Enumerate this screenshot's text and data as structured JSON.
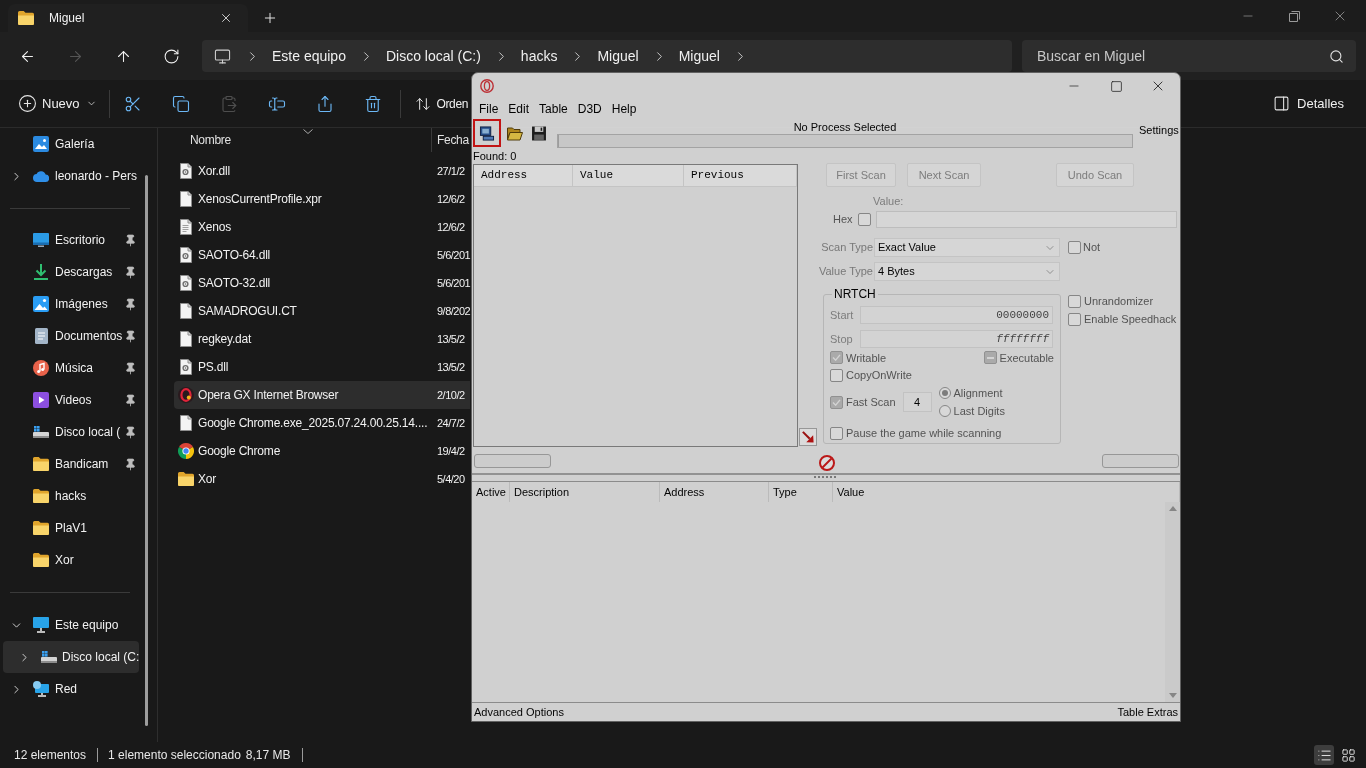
{
  "explorer": {
    "tab": {
      "title": "Miguel"
    },
    "nav_buttons": [
      {
        "kind": "back",
        "disabled": false
      },
      {
        "kind": "forward",
        "disabled": true
      },
      {
        "kind": "up",
        "disabled": false
      },
      {
        "kind": "refresh",
        "disabled": false
      }
    ],
    "breadcrumb": [
      "Este equipo",
      "Disco local (C:)",
      "hacks",
      "Miguel",
      "Miguel"
    ],
    "search": {
      "placeholder": "Buscar en Miguel"
    },
    "command_bar": {
      "new": "Nuevo",
      "tools": [
        {
          "kind": "cut",
          "disabled": false
        },
        {
          "kind": "copy",
          "disabled": false
        },
        {
          "kind": "paste",
          "disabled": true
        },
        {
          "kind": "rename",
          "disabled": false
        },
        {
          "kind": "share",
          "disabled": false
        },
        {
          "kind": "delete",
          "disabled": false
        }
      ],
      "sort": "Orden",
      "details": "Detalles"
    },
    "sidebar": {
      "groups": [
        [
          {
            "label": "Galería",
            "kind": "gallery",
            "pinned": false,
            "selected": false
          },
          {
            "label": "leonardo - Pers",
            "kind": "cloud",
            "expanded": false,
            "pinned": false,
            "selected": false
          }
        ],
        [
          {
            "label": "Escritorio",
            "kind": "desktop",
            "pinned": true,
            "selected": false
          },
          {
            "label": "Descargas",
            "kind": "downloads",
            "pinned": true,
            "selected": false
          },
          {
            "label": "Imágenes",
            "kind": "pictures",
            "pinned": true,
            "selected": false
          },
          {
            "label": "Documentos",
            "kind": "documents",
            "pinned": true,
            "selected": false
          },
          {
            "label": "Música",
            "kind": "music",
            "pinned": true,
            "selected": false
          },
          {
            "label": "Videos",
            "kind": "videos",
            "pinned": true,
            "selected": false
          },
          {
            "label": "Disco local (",
            "kind": "drive",
            "pinned": true,
            "selected": false
          },
          {
            "label": "Bandicam",
            "kind": "folder",
            "pinned": true,
            "selected": false
          },
          {
            "label": "hacks",
            "kind": "folder",
            "pinned": false,
            "selected": false
          },
          {
            "label": "PlaV1",
            "kind": "folder",
            "pinned": false,
            "selected": false
          },
          {
            "label": "Xor",
            "kind": "folder",
            "pinned": false,
            "selected": false
          }
        ],
        [
          {
            "label": "Este equipo",
            "kind": "pc",
            "expanded": true,
            "pinned": false,
            "selected": false,
            "children": [
              {
                "label": "Disco local (C:",
                "kind": "drive",
                "expanded": false,
                "pinned": false,
                "selected": true
              }
            ]
          },
          {
            "label": "Red",
            "kind": "network",
            "expanded": false,
            "pinned": false,
            "selected": false
          }
        ]
      ]
    },
    "files": {
      "columns": [
        {
          "label": "Nombre",
          "sorted": true
        },
        {
          "label": "Fecha",
          "sorted": false
        }
      ],
      "rows": [
        {
          "name": "Xor.dll",
          "kind": "dll",
          "date": "27/1/2",
          "selected": false
        },
        {
          "name": "XenosCurrentProfile.xpr",
          "kind": "file",
          "date": "12/6/2",
          "selected": false
        },
        {
          "name": "Xenos",
          "kind": "text",
          "date": "12/6/2",
          "selected": false
        },
        {
          "name": "SAOTO-64.dll",
          "kind": "dll",
          "date": "5/6/201",
          "selected": false
        },
        {
          "name": "SAOTO-32.dll",
          "kind": "dll",
          "date": "5/6/201",
          "selected": false
        },
        {
          "name": "SAMADROGUI.CT",
          "kind": "file",
          "date": "9/8/202",
          "selected": false
        },
        {
          "name": "regkey.dat",
          "kind": "file",
          "date": "13/5/2",
          "selected": false
        },
        {
          "name": "PS.dll",
          "kind": "dll",
          "date": "13/5/2",
          "selected": false
        },
        {
          "name": "Opera GX Internet Browser",
          "kind": "opera",
          "date": "2/10/2",
          "selected": true
        },
        {
          "name": "Google Chrome.exe_2025.07.24.00.25.14....",
          "kind": "file",
          "date": "24/7/2",
          "selected": false
        },
        {
          "name": "Google Chrome",
          "kind": "chrome",
          "date": "19/4/2",
          "selected": false
        },
        {
          "name": "Xor",
          "kind": "folder",
          "date": "5/4/20",
          "selected": false
        }
      ]
    },
    "status_bar": {
      "count": "12 elementos",
      "selection": "1 elemento seleccionado",
      "size": "8,17 MB",
      "views": [
        {
          "kind": "details",
          "selected": true
        },
        {
          "kind": "tiles",
          "selected": false
        }
      ]
    }
  },
  "cheat_engine": {
    "menu": [
      "File",
      "Edit",
      "Table",
      "D3D",
      "Help"
    ],
    "toolbar": [
      {
        "kind": "process",
        "highlighted": true
      },
      {
        "kind": "open",
        "highlighted": false
      },
      {
        "kind": "save",
        "highlighted": false
      }
    ],
    "process": "No Process Selected",
    "progress": {
      "level": 0
    },
    "settings": "Settings",
    "found": "Found: 0",
    "results_columns": [
      "Address",
      "Value",
      "Previous"
    ],
    "scan_buttons": [
      {
        "label": "First Scan",
        "disabled": true
      },
      {
        "label": "Next Scan",
        "disabled": true
      },
      {
        "label": "Undo Scan",
        "disabled": true
      }
    ],
    "value_label": "Value:",
    "hex": {
      "label": "Hex",
      "checked": false
    },
    "scan_type": {
      "label": "Scan Type",
      "value": "Exact Value"
    },
    "not": {
      "label": "Not",
      "checked": false
    },
    "value_type": {
      "label": "Value Type",
      "value": "4 Bytes"
    },
    "memory": {
      "title": "NRTCH",
      "start": {
        "label": "Start",
        "value": "00000000"
      },
      "stop": {
        "label": "Stop",
        "value": "ffffffff"
      },
      "flags": [
        {
          "label": "Writable",
          "checked": true,
          "indeterminate": false
        },
        {
          "label": "Executable",
          "checked": true,
          "indeterminate": true
        },
        {
          "label": "CopyOnWrite",
          "checked": false,
          "indeterminate": false
        }
      ],
      "fast_scan": {
        "label": "Fast Scan",
        "checked": true,
        "value": "4"
      },
      "alignment": [
        {
          "label": "Alignment",
          "selected": true
        },
        {
          "label": "Last Digits",
          "selected": false
        }
      ],
      "pause": {
        "label": "Pause the game while scanning",
        "checked": false
      }
    },
    "options": [
      {
        "label": "Unrandomizer",
        "checked": false
      },
      {
        "label": "Enable Speedhack",
        "checked": false
      }
    ],
    "address_columns": [
      "Active",
      "Description",
      "Address",
      "Type",
      "Value"
    ],
    "footer": {
      "left": "Advanced Options",
      "right": "Table Extras"
    }
  }
}
